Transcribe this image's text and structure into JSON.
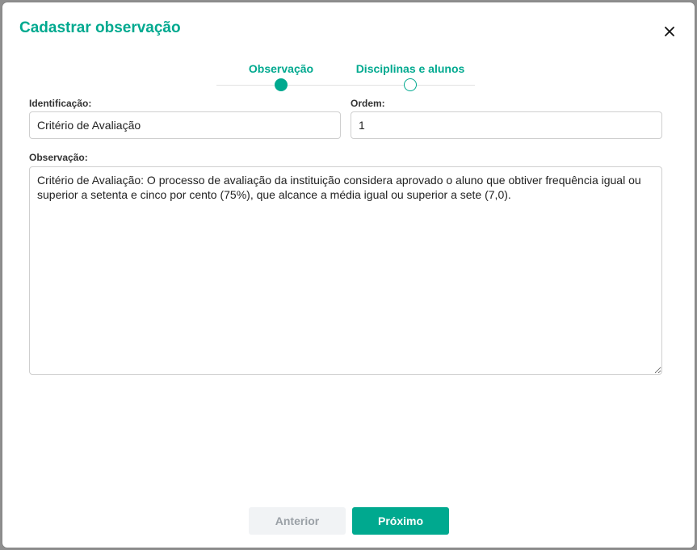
{
  "dialog": {
    "title": "Cadastrar observação",
    "close_icon": "close-icon"
  },
  "stepper": {
    "steps": [
      {
        "label": "Observação",
        "state": "active"
      },
      {
        "label": "Disciplinas e alunos",
        "state": "pending"
      }
    ]
  },
  "form": {
    "identificacao": {
      "label": "Identificação:",
      "value": "Critério de Avaliação"
    },
    "ordem": {
      "label": "Ordem:",
      "value": "1"
    },
    "observacao": {
      "label": "Observação:",
      "value": "Critério de Avaliação: O processo de avaliação da instituição considera aprovado o aluno que obtiver frequência igual ou superior a setenta e cinco por cento (75%), que alcance a média igual ou superior a sete (7,0)."
    }
  },
  "footer": {
    "prev_label": "Anterior",
    "next_label": "Próximo"
  },
  "colors": {
    "accent": "#00a98f",
    "disabled_bg": "#f1f3f5",
    "disabled_text": "#9aa0a6"
  }
}
